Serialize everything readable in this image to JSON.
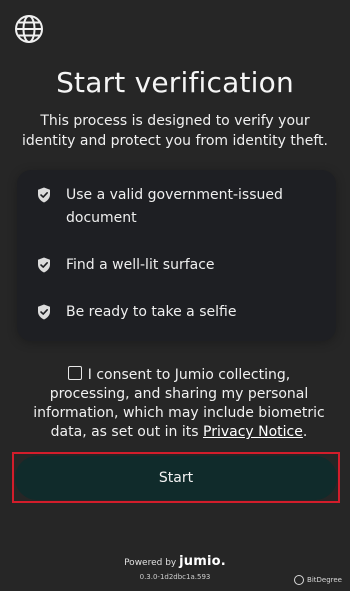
{
  "header": {
    "language_icon": "globe-icon"
  },
  "main": {
    "title": "Start verification",
    "subtitle": "This process is designed to verify your identity and protect you from identity theft."
  },
  "checklist": {
    "items": [
      {
        "label": "Use a valid government-issued document",
        "icon": "shield-check-icon"
      },
      {
        "label": "Find a well-lit surface",
        "icon": "shield-check-icon"
      },
      {
        "label": "Be ready to take a selfie",
        "icon": "shield-check-icon"
      }
    ]
  },
  "consent": {
    "checked": false,
    "text": "I consent to Jumio collecting, processing, and sharing my personal information, which may include biometric data, as set out in its ",
    "link_text": "Privacy Notice",
    "suffix": "."
  },
  "actions": {
    "start_label": "Start"
  },
  "footer": {
    "powered_by": "Powered by",
    "brand": "jumio.",
    "version": "0.3.0-1d2dbc1a.593"
  },
  "watermark": {
    "text": "BitDegree"
  },
  "colors": {
    "background": "#262626",
    "card": "#1e1f23",
    "button": "#102b2b",
    "highlight_outline": "#d31d2b"
  }
}
